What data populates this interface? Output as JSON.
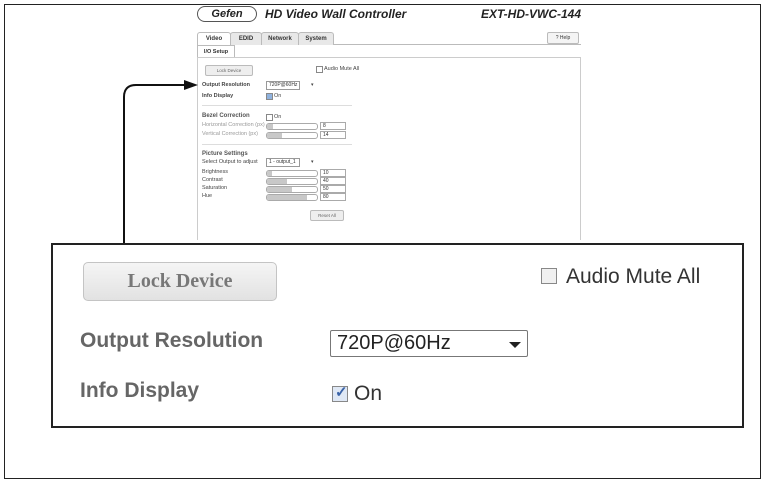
{
  "header": {
    "logo": "Gefen",
    "title": "HD Video Wall Controller",
    "model": "EXT-HD-VWC-144"
  },
  "tabs": [
    {
      "label": "Video"
    },
    {
      "label": "EDID"
    },
    {
      "label": "Network"
    },
    {
      "label": "System"
    }
  ],
  "help_label": "? Help",
  "subtab": "I/O Setup",
  "io": {
    "lock_device": "Lock Device",
    "audio_mute_all": "Audio Mute All",
    "audio_mute_checked": false,
    "output_resolution_label": "Output Resolution",
    "output_resolution_value": "720P@60Hz",
    "info_display_label": "Info Display",
    "info_display_on": "On",
    "info_display_checked": true
  },
  "bezel": {
    "title": "Bezel Correction",
    "on_label": "On",
    "checked": false,
    "horizontal_label": "Horizontal Correction (px)",
    "horizontal_value": "8",
    "vertical_label": "Vertical Correction (px)",
    "vertical_value": "14"
  },
  "picture": {
    "title": "Picture Settings",
    "select_label": "Select Output to adjust",
    "select_value": "1 - output_1",
    "brightness_label": "Brightness",
    "brightness_value": "10",
    "contrast_label": "Contrast",
    "contrast_value": "40",
    "saturation_label": "Saturation",
    "saturation_value": "50",
    "hue_label": "Hue",
    "hue_value": "80",
    "reset_all": "Reset All"
  }
}
